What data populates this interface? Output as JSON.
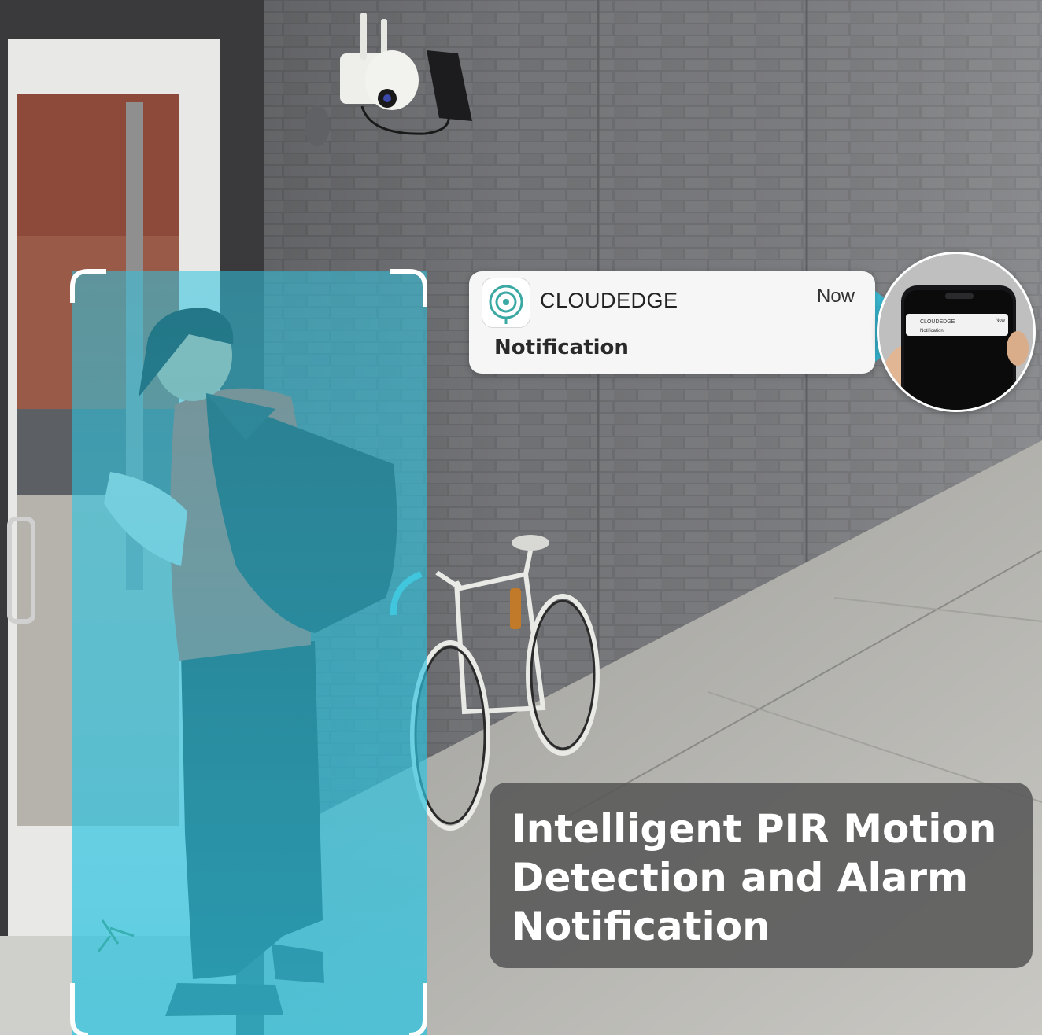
{
  "notification": {
    "app_name": "CLOUDEDGE",
    "time": "Now",
    "title": "Notification",
    "icon": "cloudedge-app-icon"
  },
  "phone_preview": {
    "app_name": "CLOUDEDGE",
    "time": "Now",
    "title": "Notification",
    "icon": "smartphone-icon"
  },
  "caption": {
    "lines": [
      "Intelligent PIR Motion",
      "Detection and Alarm",
      "Notification"
    ]
  },
  "colors": {
    "detection_zone": "#2fc4e0",
    "notification_card": "#f6f6f6",
    "caption_bg": "#585858",
    "brand_teal": "#3aa9a3"
  }
}
